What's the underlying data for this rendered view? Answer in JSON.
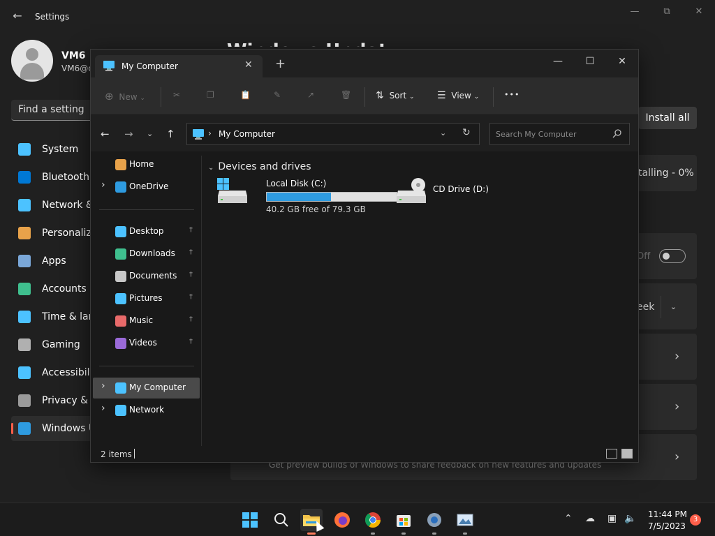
{
  "settings": {
    "title": "Settings",
    "user_name": "VM6",
    "user_email": "VM6@c",
    "search_placeholder": "Find a setting",
    "heading": "Windows Updat",
    "nav": [
      {
        "label": "System",
        "color": "#4cc2ff"
      },
      {
        "label": "Bluetooth &",
        "color": "#0078d4"
      },
      {
        "label": "Network &",
        "color": "#4cc2ff"
      },
      {
        "label": "Personaliza",
        "color": "#e8a24a"
      },
      {
        "label": "Apps",
        "color": "#7aa7d8"
      },
      {
        "label": "Accounts",
        "color": "#3fbf8e"
      },
      {
        "label": "Time & lang",
        "color": "#4cc2ff"
      },
      {
        "label": "Gaming",
        "color": "#b0b0b0"
      },
      {
        "label": "Accessibilit",
        "color": "#4cc2ff"
      },
      {
        "label": "Privacy & s",
        "color": "#9a9a9a"
      },
      {
        "label": "Windows U",
        "color": "#2e9be0"
      }
    ],
    "install_all": "Install all",
    "installing": "talling - 0%",
    "toggle_state": "Off",
    "pause_value": "eek",
    "insider_desc": "Get preview builds of Windows to share feedback on new features and updates"
  },
  "explorer": {
    "tab_title": "My Computer",
    "toolbar": {
      "new_label": "New",
      "sort_label": "Sort",
      "view_label": "View",
      "more_label": "•••"
    },
    "address": "My Computer",
    "search_placeholder": "Search My Computer",
    "sidebar": {
      "top": [
        {
          "label": "Home"
        },
        {
          "label": "OneDrive"
        }
      ],
      "quick": [
        {
          "label": "Desktop"
        },
        {
          "label": "Downloads"
        },
        {
          "label": "Documents"
        },
        {
          "label": "Pictures"
        },
        {
          "label": "Music"
        },
        {
          "label": "Videos"
        }
      ],
      "bottom": [
        {
          "label": "My Computer"
        },
        {
          "label": "Network"
        }
      ]
    },
    "group_title": "Devices and drives",
    "drives": [
      {
        "label": "Local Disk (C:)",
        "free_text": "40.2 GB free of 79.3 GB",
        "used_fraction": 0.493
      },
      {
        "label": "CD Drive (D:)"
      }
    ],
    "status_count": "2 items"
  },
  "taskbar": {
    "time": "11:44 PM",
    "date": "7/5/2023",
    "notification_count": "3"
  },
  "colors": {
    "accent": "#2e9be0",
    "badge": "#ff5f4a"
  }
}
